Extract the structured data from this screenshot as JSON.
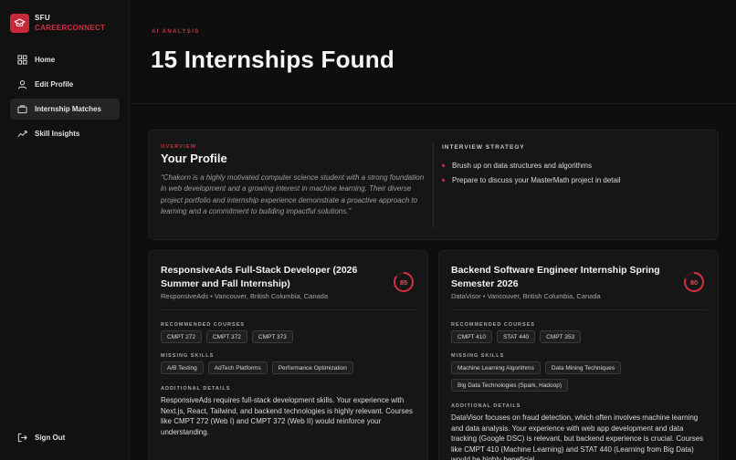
{
  "brand": {
    "line1": "SFU",
    "line2": "CAREERCONNECT"
  },
  "nav": {
    "items": [
      {
        "label": "Home",
        "icon": "grid-icon"
      },
      {
        "label": "Edit Profile",
        "icon": "user-icon"
      },
      {
        "label": "Internship Matches",
        "icon": "briefcase-icon",
        "active": true
      },
      {
        "label": "Skill Insights",
        "icon": "trend-icon"
      }
    ],
    "signout": "Sign Out"
  },
  "header": {
    "eyebrow": "AI ANALYSIS",
    "title": "15 Internships Found"
  },
  "overview": {
    "eyebrow": "OVERVIEW",
    "title": "Your Profile",
    "summary": "“Chakorn is a highly motivated computer science student with a strong foundation in web development and a growing interest in machine learning. Their diverse project portfolio and internship experience demonstrate a proactive approach to learning and a commitment to building impactful solutions.”",
    "strategy_title": "INTERVIEW STRATEGY",
    "strategy": [
      "Brush up on data structures and algorithms",
      "Prepare to discuss your MasterMath project in detail"
    ]
  },
  "labels": {
    "courses": "RECOMMENDED COURSES",
    "skills": "MISSING SKILLS",
    "details": "ADDITIONAL DETAILS"
  },
  "jobs": [
    {
      "title": "ResponsiveAds Full-Stack Developer (2026 Summer and Fall Internship)",
      "company": "ResponsiveAds • Vancouver, British Columbia, Canada",
      "score": 85,
      "courses": [
        "CMPT 272",
        "CMPT 372",
        "CMPT 373"
      ],
      "skills": [
        "A/B Testing",
        "AdTech Platforms",
        "Performance Optimization"
      ],
      "details": "ResponsiveAds requires full-stack development skills. Your experience with Next.js, React, Tailwind, and backend technologies is highly relevant. Courses like CMPT 272 (Web I) and CMPT 372 (Web II) would reinforce your understanding."
    },
    {
      "title": "Backend Software Engineer Internship Spring Semester 2026",
      "company": "DataVisor • Vancouver, British Columbia, Canada",
      "score": 80,
      "courses": [
        "CMPT 410",
        "STAT 440",
        "CMPT 353"
      ],
      "skills": [
        "Machine Learning Algorithms",
        "Data Mining Techniques",
        "Big Data Technologies (Spark, Hadoop)"
      ],
      "details": "DataVisor focuses on fraud detection, which often involves machine learning and data analysis. Your experience with web app development and data tracking (Google DSC) is relevant, but backend experience is crucial. Courses like CMPT 410 (Machine Learning) and STAT 440 (Learning from Big Data) would be highly beneficial."
    }
  ],
  "colors": {
    "accent": "#d0323f",
    "bg": "#0e0e0e",
    "card": "#161616"
  }
}
